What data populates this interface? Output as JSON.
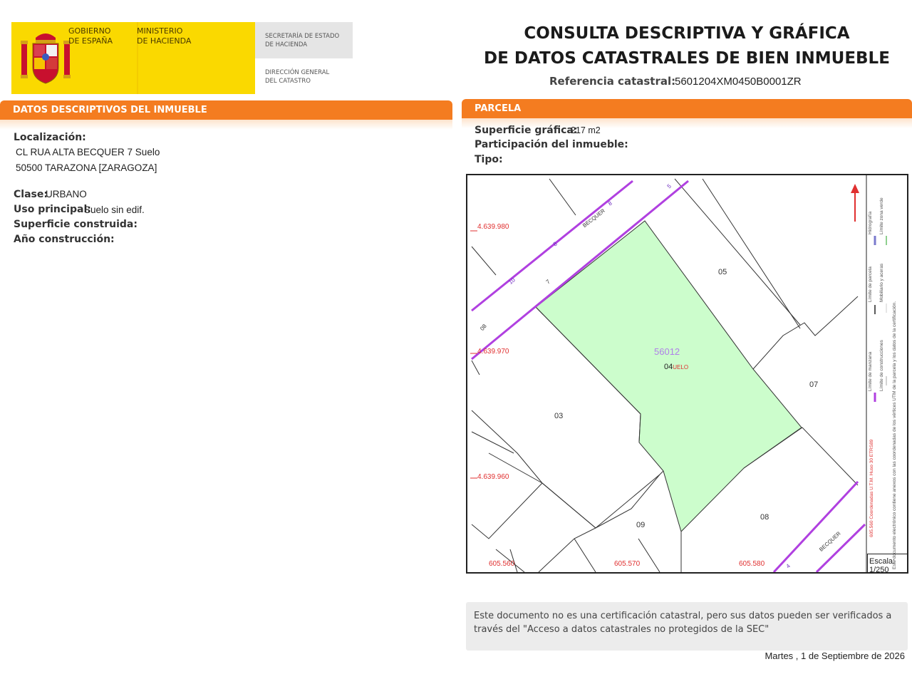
{
  "header": {
    "gov_line": "GOBIERNO\nDE ESPAÑA",
    "ministry_line": "MINISTERIO\nDE HACIENDA",
    "secretaria": "SECRETARÍA DE ESTADO\nDE HACIENDA",
    "direccion": "DIRECCIÓN GENERAL\nDEL CATASTRO",
    "title": "CONSULTA DESCRIPTIVA Y GRÁFICA\nDE DATOS CATASTRALES DE BIEN INMUEBLE",
    "ref_label": "Referencia catastral:",
    "ref_value": "5601204XM0450B0001ZR"
  },
  "left_section": {
    "title": "DATOS DESCRIPTIVOS DEL INMUEBLE",
    "localizacion_label": "Localización:",
    "address_line1": "CL RUA ALTA BECQUER 7 Suelo",
    "address_line2": "50500 TARAZONA [ZARAGOZA]",
    "clase_label": "Clase:",
    "clase_value": "URBANO",
    "uso_label": "Uso principal:",
    "uso_value": "Suelo sin edif.",
    "superficie_label": "Superficie construida:",
    "ano_label": "Año construcción:"
  },
  "right_section": {
    "title": "PARCELA",
    "superficie_grafica_label": "Superficie gráfica:",
    "superficie_grafica_value": "217 m2",
    "participacion_label": "Participación del inmueble:",
    "tipo_label": "Tipo:"
  },
  "map": {
    "coords_y": [
      "4.639.980",
      "4.639.970",
      "4.639.960"
    ],
    "coords_x": [
      "605.560",
      "605.570",
      "605.580"
    ],
    "block_id": "56012",
    "parcel_main": "04",
    "parcel_main_suffix": "UELO",
    "parcels": [
      "05",
      "03",
      "07",
      "09",
      "08"
    ],
    "street_labels": [
      "BECQUER",
      "BECQUER"
    ],
    "house_numbers": [
      "5",
      "8",
      "8",
      "10",
      "7",
      "08",
      "4"
    ],
    "legend": [
      "Límite de manzana",
      "Límite de parcela",
      "Límite de construcciones",
      "Mobiliario y aceras",
      "Límite zona verde",
      "Hidrografía"
    ],
    "legend_note1": "605.560 Coordenadas U.T.M. Huso 30 ETRS89",
    "legend_note2": "Este documento electrónico contiene anexos con las coordenadas de los vértices UTM de la parcela y los datos de la certificación.",
    "scale_label": "Escala:",
    "scale_value": "1/250",
    "colors": {
      "parcel_fill": "#ccfdcc",
      "manzana_line": "#b040e0",
      "coord_text": "#e03030"
    }
  },
  "notice": "Este documento no es una certificación catastral, pero sus datos pueden ser verificados a través del \"Acceso a datos catastrales no protegidos de la SEC\"",
  "date": "Martes , 1 de Septiembre de 2026",
  "theme": {
    "accent": "#f47c20",
    "gov_yellow": "#fad900"
  }
}
